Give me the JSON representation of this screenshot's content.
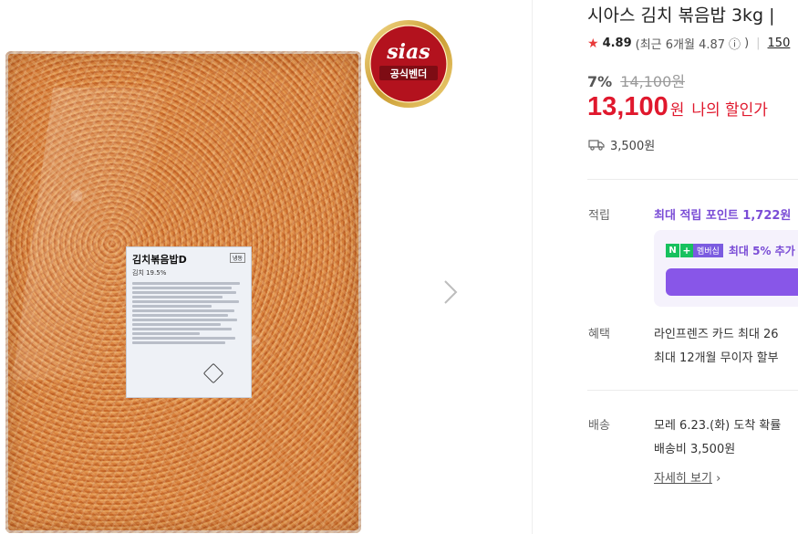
{
  "product": {
    "title": "시아스 김치 볶음밥 3kg |",
    "rating": "4.89",
    "rating_note": "(최근 6개월 4.87",
    "info_icon": "ⓘ",
    "rating_note_end": ")",
    "review_count": "150",
    "discount_rate": "7%",
    "original_price": "14,100원",
    "price": "13,100",
    "price_unit": "원",
    "my_discount": "나의 할인가",
    "shipping_fee": "3,500원"
  },
  "image": {
    "label_title": "김치볶음밥D",
    "label_sub": "김치 19.5%",
    "label_tag": "냉동",
    "badge_brand": "sias",
    "badge_text": "공식벤더"
  },
  "sections": {
    "points": {
      "label": "적립",
      "text": "최대 적립 포인트 1,722원",
      "membership_badge": "멤버십",
      "membership_text": "최대 5% 추가"
    },
    "benefits": {
      "label": "혜택",
      "line1": "라인프렌즈 카드 최대 26",
      "line2": "최대 12개월 무이자 할부"
    },
    "delivery": {
      "label": "배송",
      "line1": "모레 6.23.(화) 도착 확률",
      "line2": "배송비 3,500원",
      "detail_link": "자세히 보기",
      "detail_chevron": "›"
    }
  },
  "icons": {
    "star": "star-icon",
    "info": "info-icon",
    "truck": "truck-icon",
    "next": "chevron-right-icon"
  },
  "colors": {
    "price_red": "#e0182d",
    "points_purple": "#7a4cd6",
    "npay_green": "#17c15e"
  }
}
